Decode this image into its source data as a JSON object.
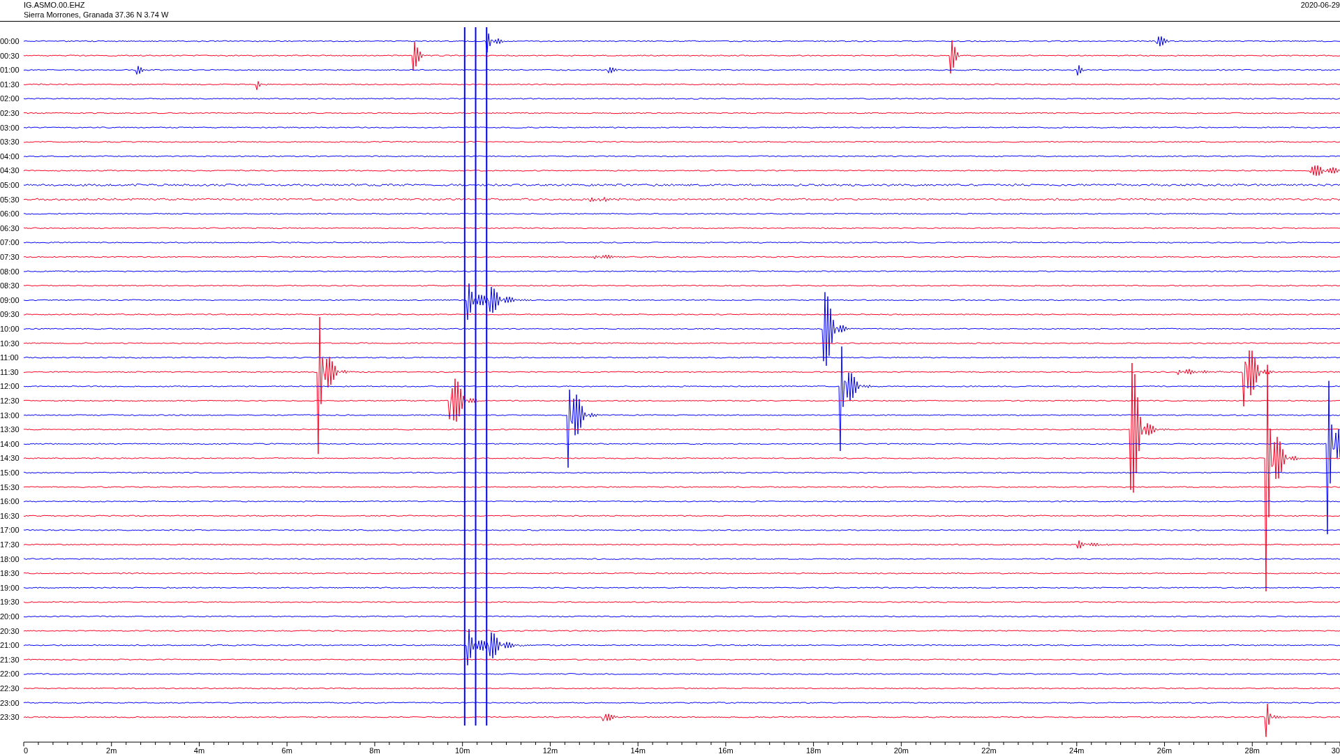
{
  "header": {
    "station": "IG.ASMO.00.EHZ",
    "location": "Sierra Morrones, Granada  37.36 N 3.74 W",
    "date": "2020-06-29"
  },
  "helicorder": {
    "time_labels": [
      "00:00",
      "00:30",
      "01:00",
      "01:30",
      "02:00",
      "02:30",
      "03:00",
      "03:30",
      "04:00",
      "04:30",
      "05:00",
      "05:30",
      "06:00",
      "06:30",
      "07:00",
      "07:30",
      "08:00",
      "08:30",
      "09:00",
      "09:30",
      "10:00",
      "10:30",
      "11:00",
      "11:30",
      "12:00",
      "12:30",
      "13:00",
      "13:30",
      "14:00",
      "14:30",
      "15:00",
      "15:30",
      "16:00",
      "16:30",
      "17:00",
      "17:30",
      "18:00",
      "18:30",
      "19:00",
      "19:30",
      "20:00",
      "20:30",
      "21:00",
      "21:30",
      "22:00",
      "22:30",
      "23:00",
      "23:30"
    ],
    "x_tick_labels": [
      "0",
      "2m",
      "4m",
      "6m",
      "8m",
      "10m",
      "12m",
      "14m",
      "16m",
      "18m",
      "20m",
      "22m",
      "24m",
      "26m",
      "28m",
      "30"
    ]
  }
}
